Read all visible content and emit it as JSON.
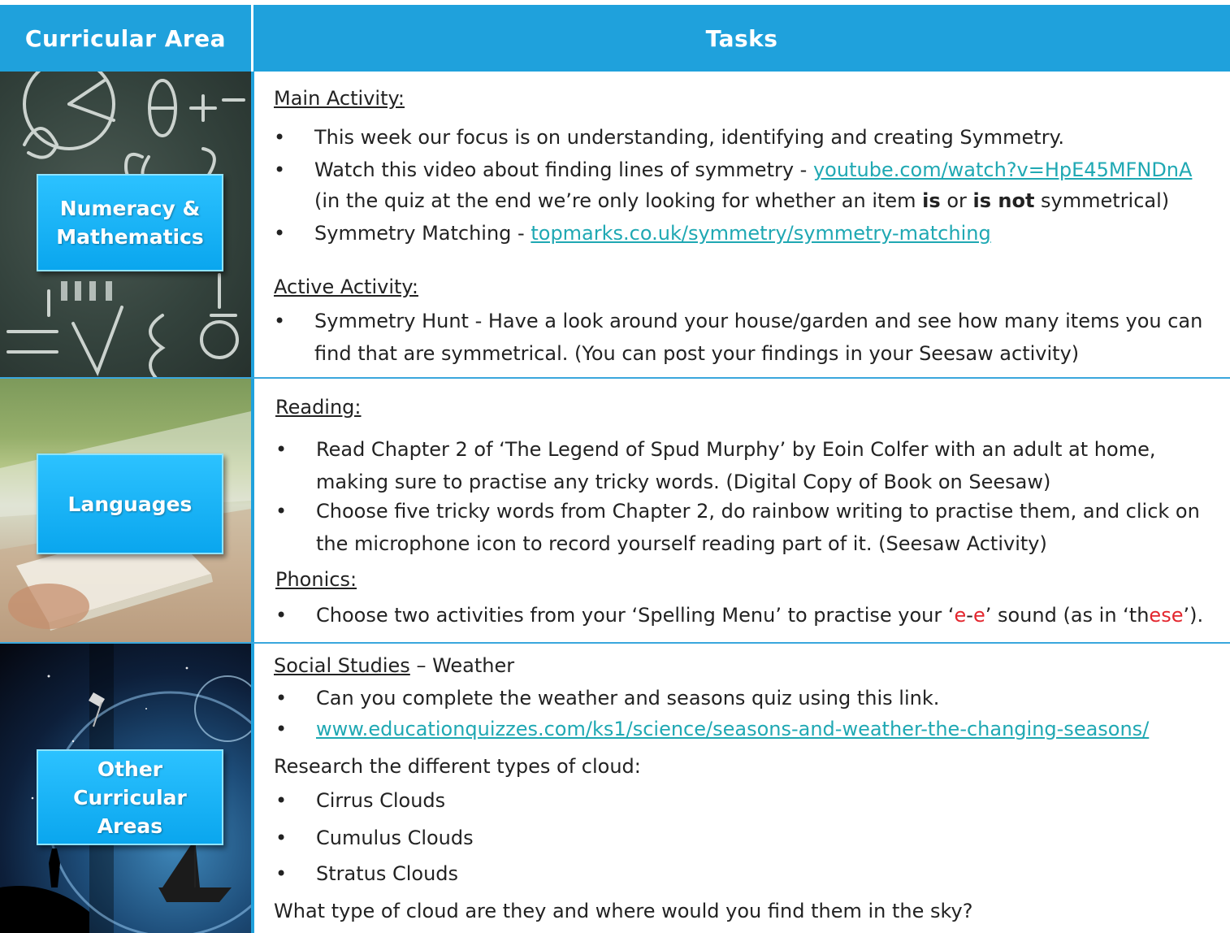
{
  "header": {
    "col1": "Curricular Area",
    "col2": "Tasks"
  },
  "numeracy": {
    "label_line1": "Numeracy &",
    "label_line2": "Mathematics",
    "main_heading": "Main Activity:",
    "b1": "This week our focus is on understanding, identifying and creating Symmetry.",
    "b2_pre": "Watch this video about finding lines of symmetry - ",
    "b2_link": "youtube.com/watch?v=HpE45MFNDnA",
    "b2_l2_pre": "(in the quiz at the end we’re only looking for whether an item ",
    "b2_is": "is",
    "b2_or": " or ",
    "b2_isnot": "is not",
    "b2_post": " symmetrical)",
    "b3_pre": "Symmetry Matching - ",
    "b3_link": "topmarks.co.uk/symmetry/symmetry-matching",
    "active_heading": "Active Activity:",
    "b4_l1": "Symmetry Hunt - Have a look around your house/garden and see how many items you can",
    "b4_l2": "find that are symmetrical. (You can post your findings in your Seesaw activity)"
  },
  "languages": {
    "label": "Languages",
    "reading_heading": "Reading:",
    "b1_l1": "Read Chapter 2 of ‘The Legend of Spud Murphy’ by Eoin Colfer with an adult at home,",
    "b1_l2": "making sure to practise any tricky words. (Digital Copy of Book on Seesaw)",
    "b2_l1": "Choose five tricky words from Chapter 2, do rainbow writing to practise them, and click on",
    "b2_l2": "the microphone icon to record yourself reading part of it. (Seesaw Activity)",
    "phonics_heading": "Phonics:",
    "b3_pre": "Choose two activities from your ‘Spelling Menu’ to practise your ‘",
    "b3_e1": "e",
    "b3_dash": "-",
    "b3_e2": "e",
    "b3_mid": "’ sound (as in ‘th",
    "b3_ese": "ese",
    "b3_post": "’)."
  },
  "other": {
    "label_line1": "Other",
    "label_line2": "Curricular",
    "label_line3": "Areas",
    "heading": "Social Studies",
    "heading_suffix": " – Weather",
    "b1": "Can you complete the weather and seasons quiz using this link.",
    "b2_link": "www.educationquizzes.com/ks1/science/seasons-and-weather-the-changing-seasons/",
    "research": "Research the different types of cloud:",
    "clouds": [
      "Cirrus Clouds",
      "Cumulus Clouds",
      "Stratus Clouds"
    ],
    "question": "What type of cloud are they and where would you find them in the sky?"
  },
  "colors": {
    "accent": "#1fa1dc",
    "link": "#1fa8b3",
    "highlight": "#e3262e",
    "label_box": "#0aa6ee"
  }
}
